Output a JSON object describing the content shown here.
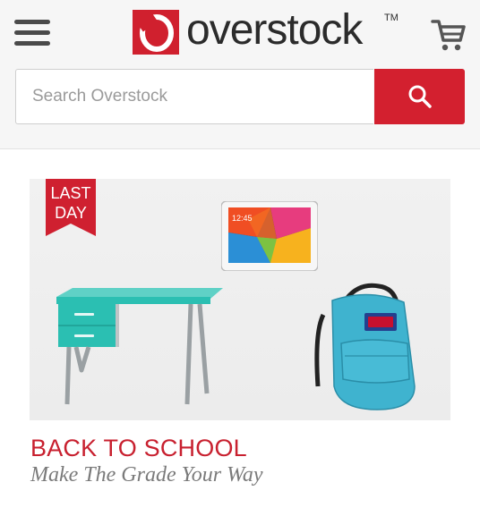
{
  "header": {
    "brand": "overstock",
    "trademark": "TM",
    "menu_icon": "hamburger-icon",
    "cart_icon": "cart-icon",
    "brand_color": "#d0202e"
  },
  "search": {
    "placeholder": "Search Overstock",
    "value": "",
    "button_icon": "search-icon"
  },
  "promo": {
    "badge_line1": "LAST",
    "badge_line2": "DAY",
    "title": "BACK TO SCHOOL",
    "subtitle": "Make The Grade Your Way",
    "tablet_time": "12:45",
    "products": [
      "tablet",
      "desk",
      "backpack"
    ]
  },
  "colors": {
    "accent": "#d3202f",
    "desk_teal": "#2bbfb2",
    "backpack_blue": "#3fb3cf"
  }
}
